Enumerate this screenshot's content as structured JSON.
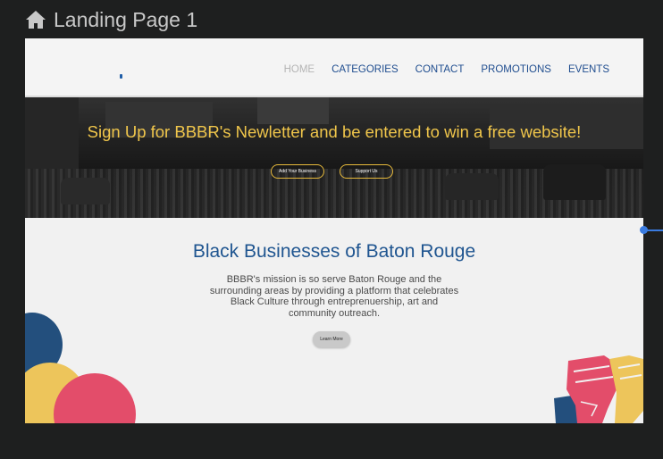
{
  "artboard": {
    "title": "Landing Page 1"
  },
  "nav": {
    "items": [
      {
        "label": "HOME",
        "active": true
      },
      {
        "label": "CATEGORIES",
        "active": false
      },
      {
        "label": "CONTACT",
        "active": false
      },
      {
        "label": "PROMOTIONS",
        "active": false
      },
      {
        "label": "EVENTS",
        "active": false
      }
    ]
  },
  "hero": {
    "headline": "Sign Up for BBBR's Newletter and be entered to win a free website!",
    "add_button": "Add Your Business",
    "support_button": "Support Us"
  },
  "about": {
    "title": "Black Businesses of Baton Rouge",
    "body": "BBBR's mission is so serve Baton Rouge and the surrounding areas by providing a platform that celebrates Black Culture through entreprenuership, art and community outreach.",
    "learn_button": "Learn More"
  },
  "colors": {
    "canvas": "#1e1f1f",
    "accent_gold": "#f0c64b",
    "brand_blue": "#1f5590",
    "connector": "#3a7be0"
  }
}
